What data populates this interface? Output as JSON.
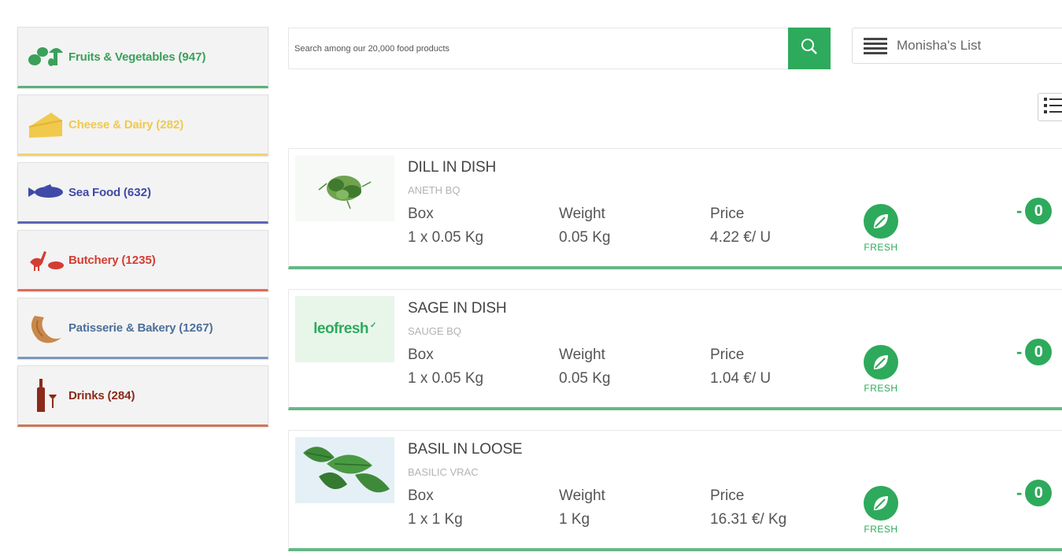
{
  "colors": {
    "brand_green": "#2eaa5c",
    "fruits": "#3aa05a",
    "cheese": "#f1c94c",
    "seafood": "#3f4aa8",
    "butchery": "#d43d33",
    "bakery": "#4d6f9a",
    "drinks": "#8a2a1a"
  },
  "sidebar": {
    "categories": [
      {
        "label": "Fruits & Vegetables",
        "count": "(947)",
        "icon": "vegetables-icon"
      },
      {
        "label": "Cheese & Dairy",
        "count": "(282)",
        "icon": "cheese-icon"
      },
      {
        "label": "Sea Food",
        "count": "(632)",
        "icon": "fish-icon"
      },
      {
        "label": "Butchery",
        "count": "(1235)",
        "icon": "poultry-icon"
      },
      {
        "label": "Patisserie & Bakery",
        "count": "(1267)",
        "icon": "croissant-icon"
      },
      {
        "label": "Drinks",
        "count": "(284)",
        "icon": "wine-icon"
      }
    ]
  },
  "search": {
    "placeholder": "Search among our 20,000 food products",
    "value": ""
  },
  "list": {
    "name": "Monisha's List"
  },
  "products": [
    {
      "name": "DILL IN DISH",
      "subname": "ANETH BQ",
      "box_label": "Box",
      "box_value": "1 x 0.05 Kg",
      "weight_label": "Weight",
      "weight_value": "0.05 Kg",
      "price_label": "Price",
      "price_value": "4.22 €/ U",
      "badge": "FRESH",
      "quantity": "0",
      "image": "dill"
    },
    {
      "name": "SAGE IN DISH",
      "subname": "SAUGE BQ",
      "box_label": "Box",
      "box_value": "1 x 0.05 Kg",
      "weight_label": "Weight",
      "weight_value": "0.05 Kg",
      "price_label": "Price",
      "price_value": "1.04 €/ U",
      "badge": "FRESH",
      "quantity": "0",
      "image": "leofresh",
      "image_text": "leofresh"
    },
    {
      "name": "BASIL IN LOOSE",
      "subname": "BASILIC VRAC",
      "box_label": "Box",
      "box_value": "1 x 1 Kg",
      "weight_label": "Weight",
      "weight_value": "1 Kg",
      "price_label": "Price",
      "price_value": "16.31 €/ Kg",
      "badge": "FRESH",
      "quantity": "0",
      "image": "basil"
    }
  ],
  "qty_minus": "-"
}
